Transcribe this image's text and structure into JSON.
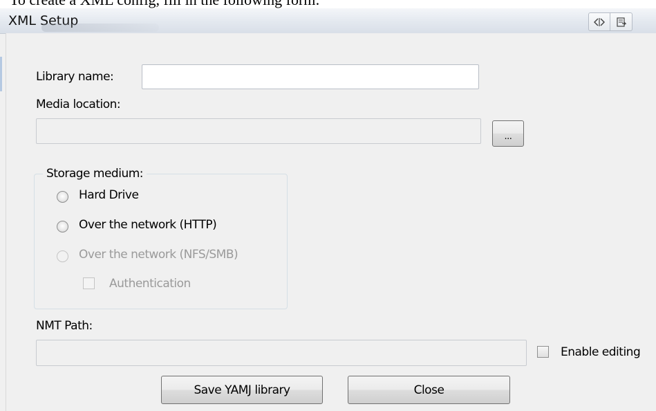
{
  "intro_text": "To create a XML config, fill in the following form:",
  "window": {
    "title": "XML Setup",
    "toolbar_icons": [
      "code-view-icon",
      "export-icon"
    ]
  },
  "form": {
    "library_name": {
      "label": "Library name:",
      "value": ""
    },
    "media_location": {
      "label": "Media location:",
      "value": "",
      "browse_label": "..."
    },
    "storage_medium": {
      "legend": "Storage medium:",
      "options": [
        {
          "label": "Hard Drive",
          "selected": false,
          "enabled": true
        },
        {
          "label": "Over the network (HTTP)",
          "selected": false,
          "enabled": true
        },
        {
          "label": "Over the network (NFS/SMB)",
          "selected": false,
          "enabled": false
        }
      ],
      "authentication": {
        "label": "Authentication",
        "checked": false,
        "enabled": false
      }
    },
    "nmt_path": {
      "label": "NMT Path:",
      "value": ""
    },
    "enable_editing": {
      "label": "Enable editing",
      "checked": false
    },
    "buttons": {
      "save": "Save YAMJ library",
      "close": "Close"
    }
  }
}
